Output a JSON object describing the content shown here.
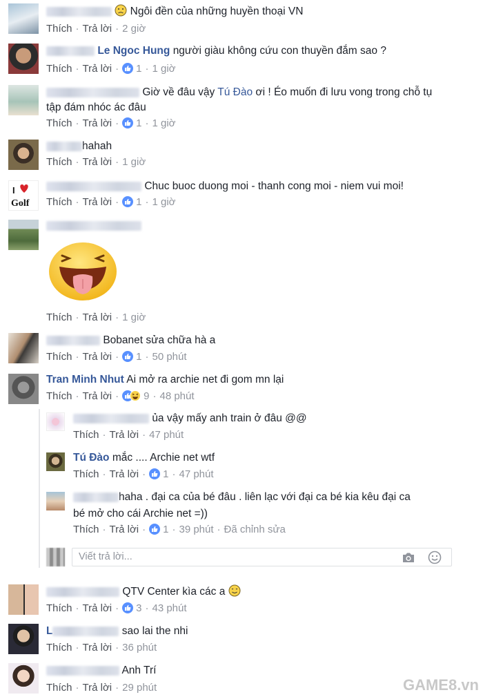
{
  "actions": {
    "like": "Thích",
    "reply": "Trả lời",
    "sep": "·"
  },
  "comments": [
    {
      "text": "Ngôi đền của những huyền thoại VN",
      "likes": "",
      "time": "2 giờ"
    },
    {
      "name": "Le Ngoc Hung",
      "text": "người giàu không cứu con thuyền đắm sao ?",
      "likes": "1",
      "time": "1 giờ"
    },
    {
      "name": "Tú Đào",
      "text_pre": "Giờ về đâu vậy ",
      "text_post": " ơi ! Éo muốn đi lưu vong trong chỗ tụ",
      "text_line2": "tập đám nhóc ác đâu",
      "likes": "1",
      "time": "1 giờ"
    },
    {
      "text": "hahah",
      "likes": "",
      "time": "1 giờ"
    },
    {
      "text": "Chuc buoc duong moi - thanh cong moi - niem vui moi!",
      "likes": "1",
      "time": "1 giờ"
    },
    {
      "text": "",
      "likes": "",
      "time": "1 giờ"
    },
    {
      "text": "Bobanet sửa chữa hà a",
      "likes": "1",
      "time": "50 phút"
    },
    {
      "name": "Tran Minh Nhut",
      "text": "Ai mở ra archie net đi gom mn lại",
      "likes": "9",
      "time": "48 phút"
    }
  ],
  "replies": [
    {
      "text": "ủa vậy mấy anh train ở đâu @@",
      "time": "47 phút"
    },
    {
      "name": "Tú Đào",
      "text": "mắc .... Archie net wtf",
      "likes": "1",
      "time": "47 phút"
    },
    {
      "text": "haha . đại ca của bé đâu . liên lạc với đại ca bé kia kêu đại ca",
      "text_line2": "bé mở cho cái Archie net =))",
      "likes": "1",
      "time": "39 phút",
      "edited": "Đã chỉnh sửa"
    }
  ],
  "reply_box": {
    "placeholder": "Viết trả lời..."
  },
  "comments_after": [
    {
      "text": "QTV Center kìa các a",
      "likes": "3",
      "time": "43 phút"
    },
    {
      "name_visible": "L",
      "text": "sao lai the nhi",
      "time": "36 phút"
    },
    {
      "text": "Anh Trí",
      "time": "29 phút"
    }
  ],
  "watermark": "GAME8.vn",
  "colors": {
    "link": "#365899",
    "meta": "#90949c",
    "like": "#5890ff"
  }
}
